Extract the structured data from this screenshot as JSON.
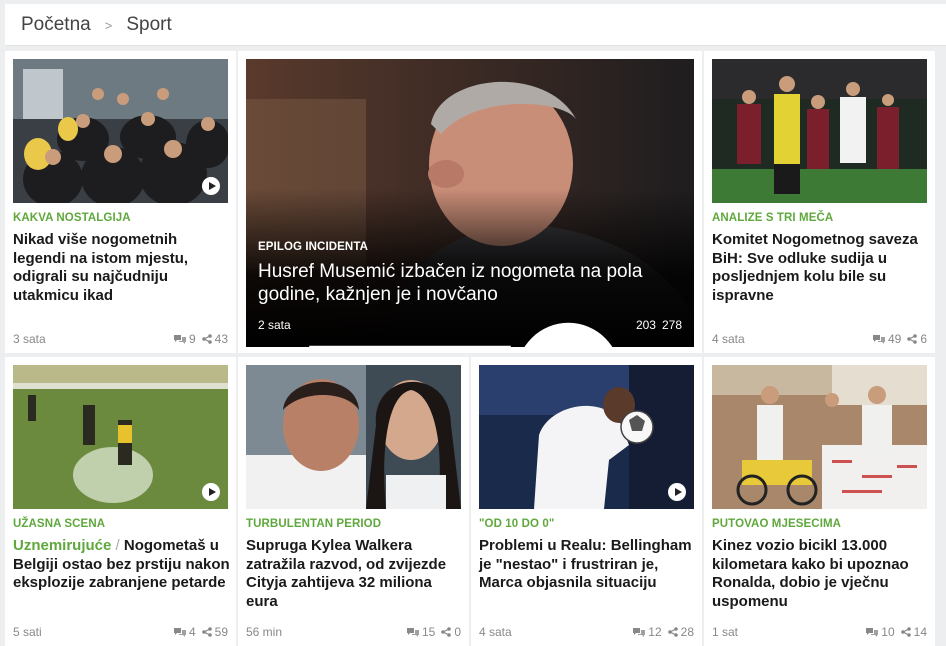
{
  "breadcrumb": {
    "home": "Početna",
    "separator": ">",
    "current": "Sport"
  },
  "cards": [
    {
      "kicker": "KAKVA NOSTALGIJA",
      "title": "Nikad više nogometnih legendi na istom mjestu, odigrali su najčudniju utakmicu ikad",
      "time": "3 sata",
      "comments": "9",
      "shares": "43",
      "video": true
    },
    {
      "kicker": "EPILOG INCIDENTA",
      "title": "Husref Musemić izbačen iz nogometa na pola godine, kažnjen je i novčano",
      "time": "2 sata",
      "comments": "203",
      "shares": "278",
      "video": false
    },
    {
      "kicker": "ANALIZE S TRI MEČA",
      "title": "Komitet Nogometnog saveza BiH: Sve odluke sudija u posljednjem kolu bile su ispravne",
      "time": "4 sata",
      "comments": "49",
      "shares": "6",
      "video": false
    },
    {
      "kicker": "UŽASNA SCENA",
      "title_prefix": "Uznemirujuće",
      "title_sep": "/",
      "title": "Nogometaš u Belgiji ostao bez prstiju nakon eksplozije zabranjene petarde",
      "time": "5 sati",
      "comments": "4",
      "shares": "59",
      "video": true
    },
    {
      "kicker": "TURBULENTAN PERIOD",
      "title": "Supruga Kylea Walkera zatražila razvod, od zvijezde Cityja zahtijeva 32 miliona eura",
      "time": "56 min",
      "comments": "15",
      "shares": "0",
      "video": false
    },
    {
      "kicker": "\"OD 10 DO 0\"",
      "title": "Problemi u Realu: Bellingham je \"nestao\" i frustriran je, Marca objasnila situaciju",
      "time": "4 sata",
      "comments": "12",
      "shares": "28",
      "video": true
    },
    {
      "kicker": "PUTOVAO MJESECIMA",
      "title": "Kinez vozio bicikl 13.000 kilometara kako bi upoznao Ronalda, dobio je vječnu uspomenu",
      "time": "1 sat",
      "comments": "10",
      "shares": "14",
      "video": false
    }
  ],
  "icons": {
    "comments": "comment-bubbles-icon",
    "shares": "share-icon",
    "video": "play-icon"
  },
  "colors": {
    "accent": "#5fa83c",
    "meta": "#888888"
  }
}
